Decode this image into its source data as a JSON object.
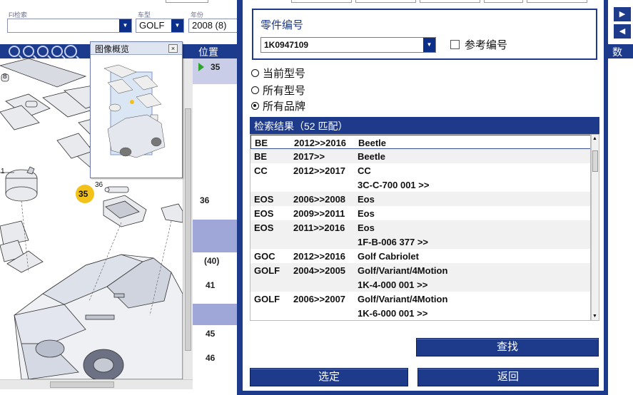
{
  "filters": {
    "fi_label": "FI检索",
    "model_label": "车型",
    "model_value": "GOLF",
    "year_label": "年份",
    "year_value": "2008 (8)",
    "fi_value": ""
  },
  "overview": {
    "title": "图像概览",
    "close": "×"
  },
  "positions": {
    "header": "位置",
    "items": [
      "35",
      "36",
      "(40)",
      "41",
      "45",
      "46"
    ],
    "callouts": [
      "35",
      "36",
      "1",
      "8"
    ]
  },
  "dialog": {
    "part_number_label": "零件编号",
    "part_number_value": "1K0947109",
    "reference_label": "参考编号",
    "radio_current_model": "当前型号",
    "radio_all_models": "所有型号",
    "radio_all_brands": "所有品牌",
    "results_header": "检索结果（52 匹配）",
    "rows": [
      {
        "code": "BE",
        "years": "2012>>2016",
        "name": "Beetle"
      },
      {
        "code": "BE",
        "years": "2017>>",
        "name": "Beetle"
      },
      {
        "code": "CC",
        "years": "2012>>2017",
        "name": "CC"
      },
      {
        "code": "",
        "years": "",
        "name": "3C-C-700 001 >>"
      },
      {
        "code": "EOS",
        "years": "2006>>2008",
        "name": "Eos"
      },
      {
        "code": "EOS",
        "years": "2009>>2011",
        "name": "Eos"
      },
      {
        "code": "EOS",
        "years": "2011>>2016",
        "name": "Eos"
      },
      {
        "code": "",
        "years": "",
        "name": "1F-B-006 377 >>"
      },
      {
        "code": "GOC",
        "years": "2012>>2016",
        "name": "Golf Cabriolet"
      },
      {
        "code": "GOLF",
        "years": "2004>>2005",
        "name": "Golf/Variant/4Motion"
      },
      {
        "code": "",
        "years": "",
        "name": "1K-4-000 001 >>"
      },
      {
        "code": "GOLF",
        "years": "2006>>2007",
        "name": "Golf/Variant/4Motion"
      },
      {
        "code": "",
        "years": "",
        "name": "1K-6-000 001 >>"
      }
    ],
    "search_button": "查找",
    "select_button": "选定",
    "back_button": "返回"
  },
  "right_panel": {
    "header": "数"
  },
  "colors": {
    "brand_blue": "#1e3a8a",
    "band_lavender": "#9ea7d8",
    "callout_yellow": "#f2c21a"
  }
}
